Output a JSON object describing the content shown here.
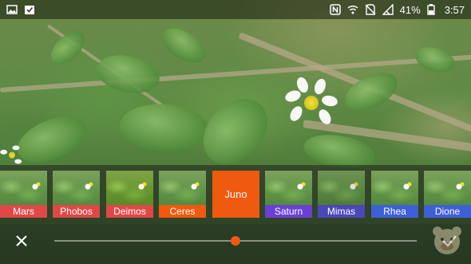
{
  "status_bar": {
    "left_icons": [
      "image-icon",
      "download-done-icon"
    ],
    "right_icons": [
      "nfc-icon",
      "wifi-icon",
      "no-sim-icon",
      "signal-icon"
    ],
    "battery": "41%",
    "time": "3:57"
  },
  "filters": {
    "items": [
      {
        "label": "Mars",
        "color": "#e04848"
      },
      {
        "label": "Phobos",
        "color": "#e04848"
      },
      {
        "label": "Deimos",
        "color": "#e04848"
      },
      {
        "label": "Ceres",
        "color": "#ef5a10"
      },
      {
        "label": "Juno",
        "color": "#ef5a10",
        "selected": true
      },
      {
        "label": "Saturn",
        "color": "#6b3fd6"
      },
      {
        "label": "Mimas",
        "color": "#4a47b8"
      },
      {
        "label": "Rhea",
        "color": "#3f5fd8"
      },
      {
        "label": "Dione",
        "color": "#3f5fd8"
      }
    ]
  },
  "controls": {
    "cancel_icon": "close-icon",
    "confirm_icon": "check-icon",
    "intensity": 0.5,
    "accent": "#ef5a10"
  }
}
